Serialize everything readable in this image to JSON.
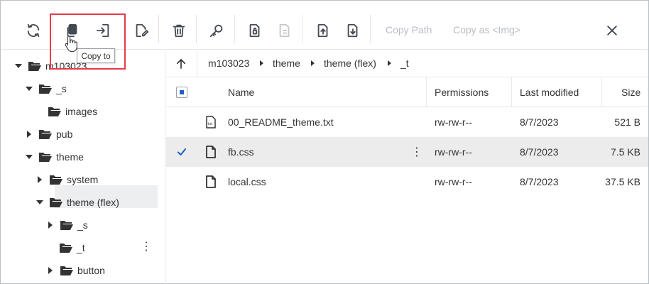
{
  "toolbar": {
    "buttons": [
      {
        "name": "refresh-icon"
      },
      {
        "name": "copy-icon"
      },
      {
        "name": "copy-to-icon"
      },
      {
        "name": "rename-icon"
      },
      {
        "name": "delete-icon"
      },
      {
        "name": "key-icon"
      },
      {
        "name": "file-lock-icon"
      },
      {
        "name": "file-disabled-icon"
      },
      {
        "name": "upload-icon"
      },
      {
        "name": "download-icon"
      }
    ],
    "copy_path_label": "Copy Path",
    "copy_as_img_label": "Copy as <Img>",
    "tooltip": "Copy to",
    "colors": {
      "icon": "#444a52",
      "disabled_text": "#b8bdc3",
      "highlight": "#e8394a"
    }
  },
  "tree": {
    "items": [
      {
        "label": "m103023",
        "expanded": true
      },
      {
        "label": "_s",
        "expanded": true
      },
      {
        "label": "images"
      },
      {
        "label": "pub",
        "expanded": false
      },
      {
        "label": "theme",
        "expanded": true
      },
      {
        "label": "system",
        "expanded": false
      },
      {
        "label": "theme (flex)",
        "expanded": true
      },
      {
        "label": "_s",
        "expanded": false
      },
      {
        "label": "_t",
        "selected": true
      },
      {
        "label": "button",
        "expanded": false
      }
    ]
  },
  "breadcrumb": {
    "items": [
      "m103023",
      "theme",
      "theme (flex)",
      "_t"
    ]
  },
  "table": {
    "headers": {
      "name": "Name",
      "permissions": "Permissions",
      "modified": "Last modified",
      "size": "Size"
    },
    "rows": [
      {
        "name": "00_README_theme.txt",
        "icon": "txt-file-icon",
        "permissions": "rw-rw-r--",
        "modified": "8/7/2023",
        "size": "521 B",
        "selected": false
      },
      {
        "name": "fb.css",
        "icon": "file-icon",
        "permissions": "rw-rw-r--",
        "modified": "8/7/2023",
        "size": "7.5 KB",
        "selected": true
      },
      {
        "name": "local.css",
        "icon": "file-icon",
        "permissions": "rw-rw-r--",
        "modified": "8/7/2023",
        "size": "37.5 KB",
        "selected": false
      }
    ]
  }
}
